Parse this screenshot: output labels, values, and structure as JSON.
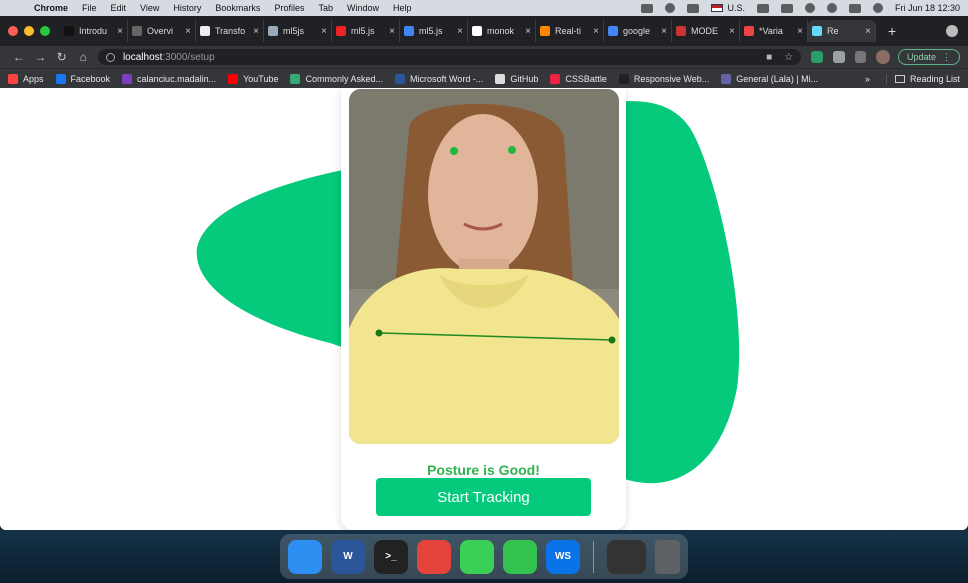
{
  "menubar": {
    "app": "Chrome",
    "items": [
      "File",
      "Edit",
      "View",
      "History",
      "Bookmarks",
      "Profiles",
      "Tab",
      "Window",
      "Help"
    ],
    "input_source": "U.S.",
    "clock": "Fri Jun 18  12:30"
  },
  "tabs": [
    {
      "label": "Introdu",
      "fav": "#111"
    },
    {
      "label": "Overvi",
      "fav": "#666"
    },
    {
      "label": "Transfo",
      "fav": "#eee"
    },
    {
      "label": "ml5js",
      "fav": "#9ab"
    },
    {
      "label": "ml5.js",
      "fav": "#e22"
    },
    {
      "label": "ml5.js",
      "fav": "#4285f4"
    },
    {
      "label": "monok",
      "fav": "#fff"
    },
    {
      "label": "Real-ti",
      "fav": "#f80"
    },
    {
      "label": "google",
      "fav": "#4285f4"
    },
    {
      "label": "MODE",
      "fav": "#c33"
    },
    {
      "label": "*Varia",
      "fav": "#e44"
    },
    {
      "label": "Re",
      "fav": "#61dafb"
    }
  ],
  "toolbar": {
    "url_host": "localhost",
    "url_path": ":3000/setup",
    "update_label": "Update"
  },
  "bookmarks": {
    "items": [
      {
        "label": "Apps",
        "color": "#f44"
      },
      {
        "label": "Facebook",
        "color": "#1877f2"
      },
      {
        "label": "calanciuc.madalin...",
        "color": "#7e3fbf"
      },
      {
        "label": "YouTube",
        "color": "#f00"
      },
      {
        "label": "Commonly Asked...",
        "color": "#3a7"
      },
      {
        "label": "Microsoft Word -...",
        "color": "#2b579a"
      },
      {
        "label": "GitHub",
        "color": "#ddd"
      },
      {
        "label": "CSSBattle",
        "color": "#e24"
      },
      {
        "label": "Responsive Web...",
        "color": "#222"
      },
      {
        "label": "General (Lala) | Mi...",
        "color": "#6264a7"
      }
    ],
    "more": "»",
    "reading_list": "Reading List"
  },
  "setup": {
    "status": "Posture is Good!",
    "start_button": "Start Tracking",
    "accent": "#05c97b",
    "status_color": "#2fb24f"
  },
  "dock": {
    "apps": [
      {
        "name": "finder-icon",
        "label": "",
        "color": "#2b8ef0"
      },
      {
        "name": "word-icon",
        "label": "W",
        "color": "#2b579a"
      },
      {
        "name": "terminal-icon",
        "label": ">_",
        "color": "#222"
      },
      {
        "name": "chrome-icon",
        "label": "",
        "color": "#e5443a"
      },
      {
        "name": "messages-icon",
        "label": "",
        "color": "#3ccf55"
      },
      {
        "name": "facetime-icon",
        "label": "",
        "color": "#33c24d"
      },
      {
        "name": "webstorm-icon",
        "label": "WS",
        "color": "#0b73e8"
      }
    ]
  }
}
